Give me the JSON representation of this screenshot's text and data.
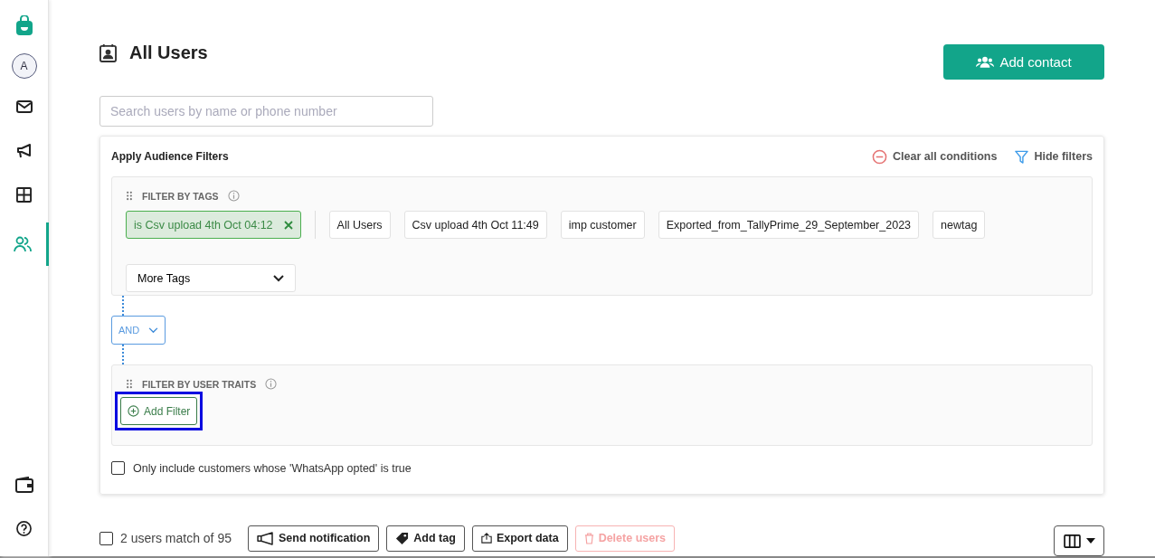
{
  "sidebar": {
    "avatar": "A",
    "items": [
      {
        "kind": "mail",
        "selected": false
      },
      {
        "kind": "megaphone",
        "selected": false
      },
      {
        "kind": "grid",
        "selected": false
      },
      {
        "kind": "users",
        "selected": true
      }
    ],
    "bottom_items": [
      {
        "kind": "wallet"
      },
      {
        "kind": "help"
      }
    ]
  },
  "header": {
    "title": "All Users",
    "add_button": "Add contact"
  },
  "search": {
    "placeholder": "Search users by name or phone number"
  },
  "filters": {
    "title": "Apply Audience Filters",
    "clear": "Clear all conditions",
    "hide": "Hide filters",
    "tags_section": {
      "title": "FILTER BY TAGS",
      "tags": [
        {
          "label": "is Csv upload 4th Oct 04:12",
          "selected": true
        },
        {
          "label": "All Users",
          "selected": false
        },
        {
          "label": "Csv upload 4th Oct 11:49",
          "selected": false
        },
        {
          "label": "imp customer",
          "selected": false
        },
        {
          "label": "Exported_from_TallyPrime_29_September_2023",
          "selected": false
        },
        {
          "label": "newtag",
          "selected": false
        }
      ],
      "more": "More Tags"
    },
    "operator": "AND",
    "traits_section": {
      "title": "FILTER BY USER TRAITS",
      "add_filter": "Add Filter",
      "highlighted": true
    },
    "whatsapp": {
      "label": "Only include customers whose 'WhatsApp opted' is true",
      "checked": false
    }
  },
  "footer": {
    "select_all_checked": false,
    "count": "2 users match of 95",
    "actions": [
      {
        "kind": "notify",
        "label": "Send notification",
        "disabled": false
      },
      {
        "kind": "tag",
        "label": "Add tag",
        "disabled": false
      },
      {
        "kind": "export",
        "label": "Export data",
        "disabled": false
      },
      {
        "kind": "delete",
        "label": "Delete users",
        "disabled": true
      }
    ]
  }
}
